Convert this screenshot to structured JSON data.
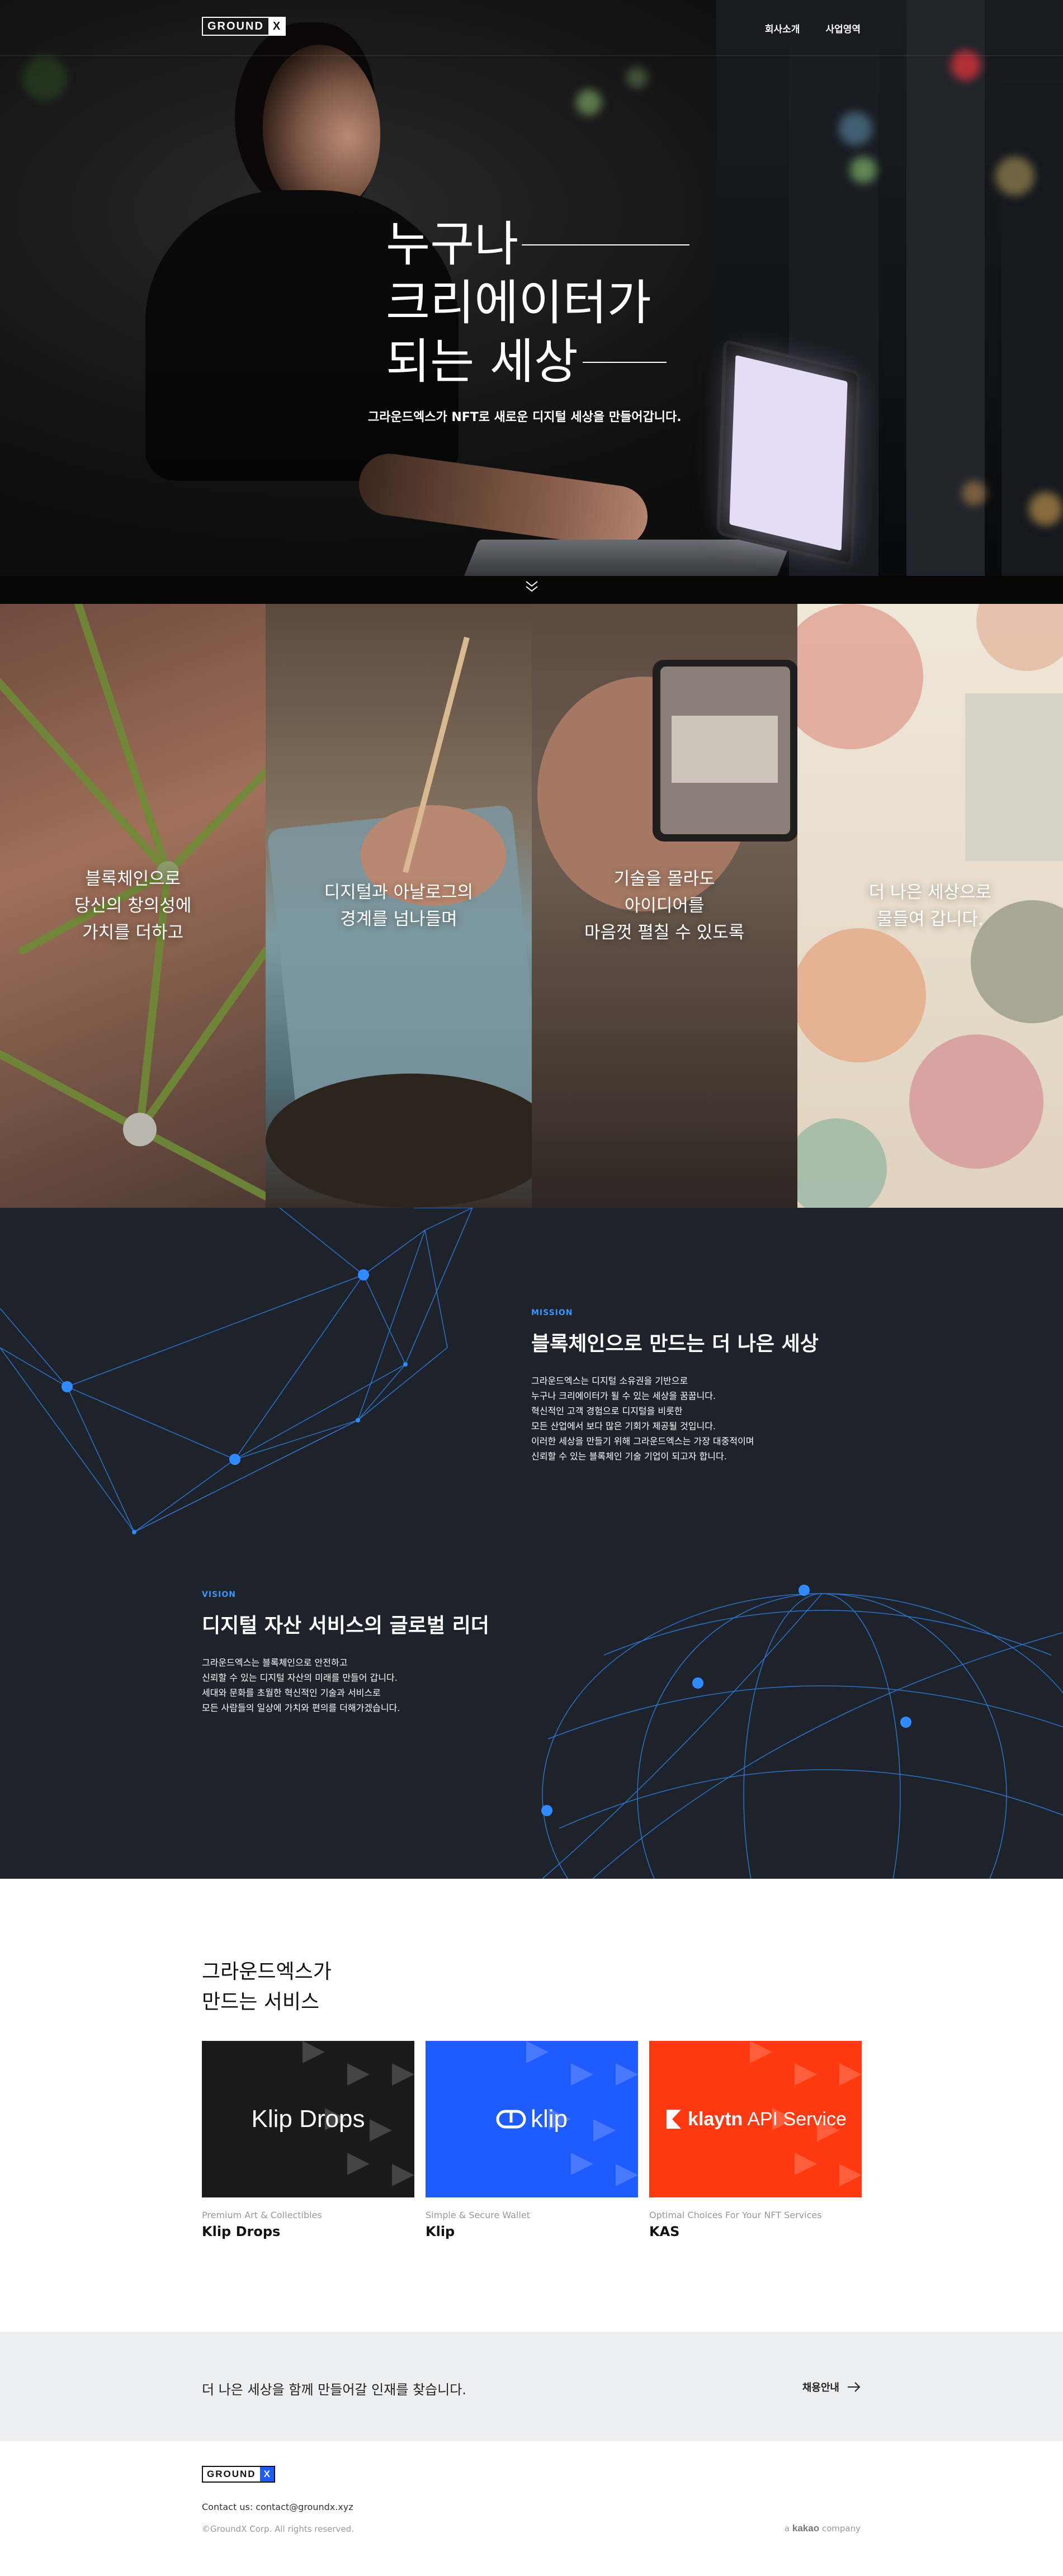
{
  "header": {
    "logo_left": "GROUND",
    "logo_right": "X",
    "nav": [
      "회사소개",
      "사업영역"
    ]
  },
  "hero": {
    "title_lines": [
      "누구나",
      "크리에이터가",
      "되는 세상"
    ],
    "subtitle": "그라운드엑스가 NFT로 새로운 디지털 세상을 만들어갑니다.",
    "scroll_icon": "chevron-double-down-icon"
  },
  "panels": [
    {
      "text": "블록체인으로\n당신의 창의성에\n가치를 더하고"
    },
    {
      "text": "디지털과 아날로그의\n경계를 넘나들며"
    },
    {
      "text": "기술을 몰라도\n아이디어를\n마음껏 펼칠 수 있도록"
    },
    {
      "text": "더 나은 세상으로\n물들여 갑니다."
    }
  ],
  "mission": {
    "label": "MISSION",
    "title": "블록체인으로 만드는 더 나은 세상",
    "body": "그라운드엑스는 디지털 소유권을 기반으로\n누구나 크리에이터가 될 수 있는 세상을 꿈꿉니다.\n혁신적인 고객 경험으로 디지털을 비롯한\n모든 산업에서 보다 많은 기회가 제공될 것입니다.\n이러한 세상을 만들기 위해 그라운드엑스는 가장 대중적이며\n신뢰할 수 있는 블록체인 기술 기업이 되고자 합니다."
  },
  "vision": {
    "label": "VISION",
    "title": "디지털 자산 서비스의 글로벌 리더",
    "body": "그라운드엑스는 블록체인으로 안전하고\n신뢰할 수 있는 디지털 자산의 미래를 만들어 갑니다.\n세대와 문화를 초월한 혁신적인 기술과 서비스로\n모든 사람들의 일상에 가치와 편의를 더해가겠습니다."
  },
  "services": {
    "title": "그라운드엑스가\n만드는 서비스",
    "cards": [
      {
        "brand": "Klip Drops",
        "subtitle": "Premium Art & Collectibles",
        "name": "Klip Drops",
        "color": "#1a1a1a",
        "icon": "klip-drops-logo"
      },
      {
        "brand": "klip",
        "subtitle": "Simple & Secure Wallet",
        "name": "Klip",
        "color": "#1f5cff",
        "icon": "klip-logo"
      },
      {
        "brand": "klaytn",
        "brand_suffix": "API Service",
        "subtitle": "Optimal Choices For Your NFT Services",
        "name": "KAS",
        "color": "#ff3a12",
        "icon": "klaytn-logo"
      }
    ]
  },
  "recruit": {
    "text": "더 나은 세상을 함께 만들어갈 인재를 찾습니다.",
    "link": "채용안내",
    "icon": "arrow-right-icon"
  },
  "footer": {
    "logo_left": "GROUND",
    "logo_right": "X",
    "contact": "Contact us: contact@groundx.xyz",
    "copyright": "©GroundX Corp. All rights reserved.",
    "kakao_prefix": "a",
    "kakao_brand": "kakao",
    "kakao_suffix": "company"
  },
  "colors": {
    "accent": "#3b95ff",
    "dark_section": "#1d222b",
    "klip_blue": "#1f5cff",
    "kas_red": "#ff3a12"
  }
}
